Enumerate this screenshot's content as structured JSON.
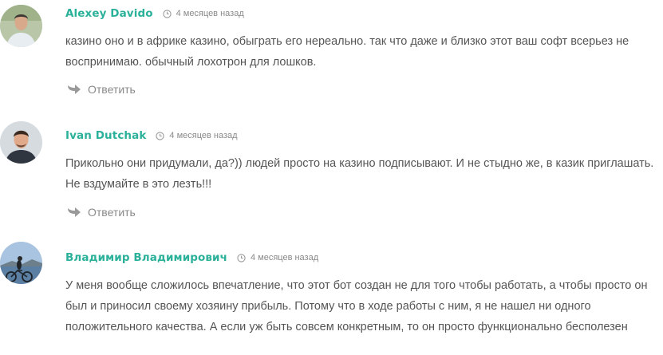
{
  "comments": [
    {
      "author": "Alexey Davido",
      "time": "4 месяцев назад",
      "text": "казино оно и в африке казино, обыграть его нереально. так что даже и близко этот ваш софт всерьез не воспринимаю. обычный лохотрон для лошков.",
      "reply": "Ответить"
    },
    {
      "author": "Ivan Dutchak",
      "time": "4 месяцев назад",
      "text": "Прикольно они придумали, да?)) людей просто на казино подписывают. И не стыдно же, в казик приглашать. Не вздумайте в это лезть!!!",
      "reply": "Ответить"
    },
    {
      "author": "Владимир Владимирович",
      "time": "4 месяцев назад",
      "text": "У меня вообще сложилось впечатление, что этот бот создан не для того чтобы работать, а чтобы просто он был и приносил своему хозяину прибыль. Потому что в ходе работы с ним, я не нашел ни одного положительного качества. А если уж быть совсем конкретным, то он просто функционально бесполезен"
    }
  ],
  "colors": {
    "author": "#2bb19a",
    "text": "#555555",
    "muted": "#8a8a8a"
  },
  "icons": {
    "time": "clock-icon",
    "reply": "reply-arrow-icon"
  }
}
